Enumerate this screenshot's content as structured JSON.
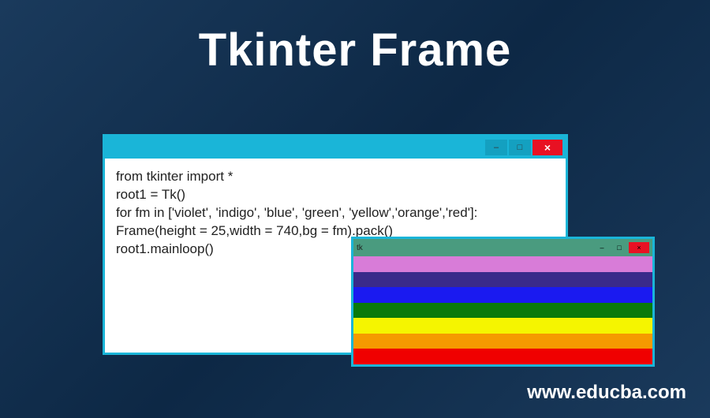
{
  "title": "Tkinter Frame",
  "codeWindow": {
    "lines": [
      "from tkinter import *",
      "root1 = Tk()",
      "for fm in ['violet', 'indigo', 'blue', 'green', 'yellow','orange','red']:",
      "Frame(height = 25,width = 740,bg = fm).pack()",
      "root1.mainloop()"
    ],
    "buttons": {
      "minimize": "–",
      "maximize": "□",
      "close": "×"
    }
  },
  "rainbowWindow": {
    "tkLabel": "tk",
    "stripes": [
      {
        "color": "#d87cd8"
      },
      {
        "color": "#3a2a8a"
      },
      {
        "color": "#1a1af0"
      },
      {
        "color": "#0a7a0a"
      },
      {
        "color": "#f5f500"
      },
      {
        "color": "#f59a00"
      },
      {
        "color": "#f00000"
      }
    ],
    "buttons": {
      "minimize": "–",
      "maximize": "□",
      "close": "×"
    }
  },
  "footer": "www.educba.com"
}
